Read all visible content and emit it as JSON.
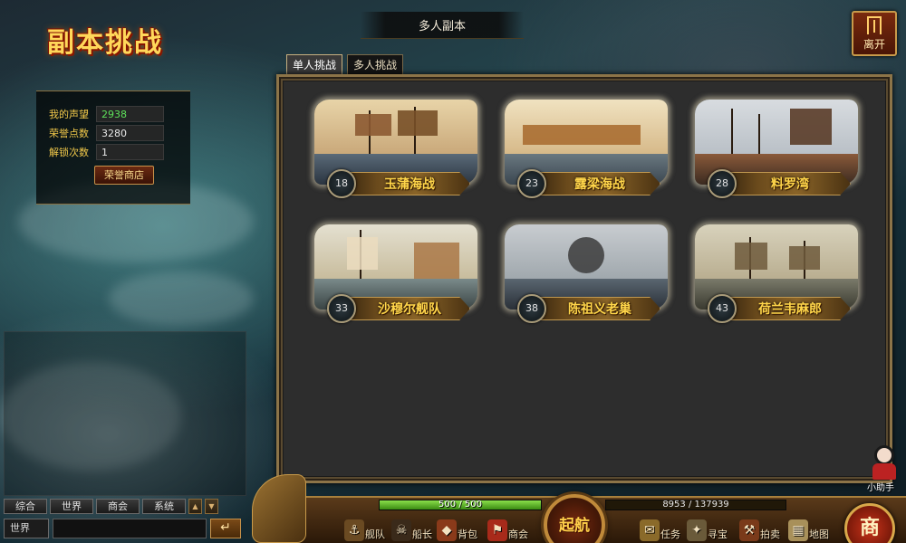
{
  "header": {
    "title": "副本挑战",
    "banner_title": "多人副本",
    "leave_label": "离开"
  },
  "stats": {
    "reputation_label": "我的声望",
    "reputation_value": "2938",
    "honor_label": "荣誉点数",
    "honor_value": "3280",
    "unlock_label": "解锁次数",
    "unlock_value": "1",
    "honor_shop_label": "荣誉商店"
  },
  "tabs": [
    {
      "label": "单人挑战",
      "active": true
    },
    {
      "label": "多人挑战",
      "active": false
    }
  ],
  "dungeons": [
    {
      "level": "18",
      "name": "玉蒲海战"
    },
    {
      "level": "23",
      "name": "露梁海战"
    },
    {
      "level": "28",
      "name": "料罗湾"
    },
    {
      "level": "33",
      "name": "沙穆尔舰队"
    },
    {
      "level": "38",
      "name": "陈祖义老巢"
    },
    {
      "level": "43",
      "name": "荷兰韦麻郎"
    }
  ],
  "chat": {
    "tabs": [
      "综合",
      "世界",
      "商会",
      "系统"
    ],
    "channel": "世界",
    "send_icon": "enter-icon"
  },
  "helper_label": "小助手",
  "bottom_bar": {
    "exp_text": "500 / 500",
    "exp_fraction": 1.0,
    "gold_text": "8953 / 137939",
    "sail_label": "起航",
    "merchant_label": "商",
    "menu": [
      "舰队",
      "船长",
      "背包",
      "商会",
      "任务",
      "寻宝",
      "拍卖",
      "地图"
    ]
  },
  "colors": {
    "title_gold": "#ffd85a",
    "reputation_green": "#5ee05a",
    "panel_border": "#8c7448"
  }
}
